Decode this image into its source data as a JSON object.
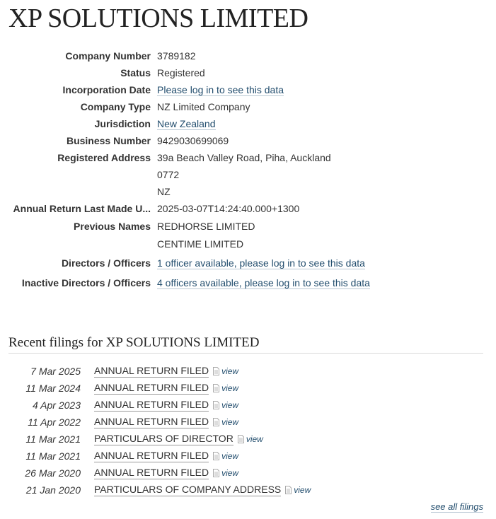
{
  "title": "XP SOLUTIONS LIMITED",
  "attributes": {
    "company_number": {
      "label": "Company Number",
      "value": "3789182"
    },
    "status": {
      "label": "Status",
      "value": "Registered"
    },
    "incorporation_date": {
      "label": "Incorporation Date",
      "value": "Please log in to see this data"
    },
    "company_type": {
      "label": "Company Type",
      "value": "NZ Limited Company"
    },
    "jurisdiction": {
      "label": "Jurisdiction",
      "value": "New Zealand"
    },
    "business_number": {
      "label": "Business Number",
      "value": "9429030699069"
    },
    "registered_address": {
      "label": "Registered Address",
      "lines": [
        "39a Beach Valley Road, Piha, Auckland",
        "0772",
        "NZ"
      ]
    },
    "annual_return": {
      "label": "Annual Return Last Made U...",
      "value": "2025-03-07T14:24:40.000+1300"
    },
    "previous_names": {
      "label": "Previous Names",
      "lines": [
        "REDHORSE LIMITED",
        "CENTIME LIMITED"
      ]
    },
    "directors": {
      "label": "Directors / Officers",
      "value": "1 officer available, please log in to see this data"
    },
    "inactive_directors": {
      "label": "Inactive Directors / Officers",
      "value": "4 officers available, please log in to see this data"
    }
  },
  "filings": {
    "heading": "Recent filings for XP SOLUTIONS LIMITED",
    "view_label": "view",
    "items": [
      {
        "date": "7 Mar 2025",
        "description": "ANNUAL RETURN FILED"
      },
      {
        "date": "11 Mar 2024",
        "description": "ANNUAL RETURN FILED"
      },
      {
        "date": "4 Apr 2023",
        "description": "ANNUAL RETURN FILED"
      },
      {
        "date": "11 Apr 2022",
        "description": "ANNUAL RETURN FILED"
      },
      {
        "date": "11 Mar 2021",
        "description": "PARTICULARS OF DIRECTOR"
      },
      {
        "date": "11 Mar 2021",
        "description": "ANNUAL RETURN FILED"
      },
      {
        "date": "26 Mar 2020",
        "description": "ANNUAL RETURN FILED"
      },
      {
        "date": "21 Jan 2020",
        "description": "PARTICULARS OF COMPANY ADDRESS"
      }
    ],
    "see_all": "see all filings"
  },
  "colors": {
    "link": "#234e6e",
    "text": "#333333"
  }
}
